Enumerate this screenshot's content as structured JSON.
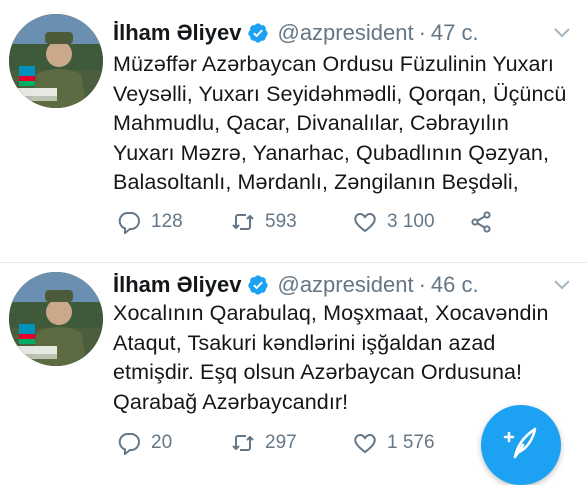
{
  "colors": {
    "accent": "#1da1f2",
    "verified": "#1da1f2",
    "muted": "#657786",
    "text": "#14171a"
  },
  "tweets": [
    {
      "author_name": "İlham Əliyev",
      "handle": "@azpresident",
      "separator": "·",
      "time": "47 с.",
      "avatar_caption": "QARABAĞ AZƏRBAYCANDIR!",
      "text": "Müzəffər Azərbaycan Ordusu Füzulinin Yuxarı Veysəlli, Yuxarı Seyidəhmədli, Qorqan, Üçüncü Mahmudlu, Qacar, Divanalılar, Cəbrayılın Yuxarı Məzrə, Yanarhac, Qubadlının Qəzyan, Balasoltanlı, Mərdanlı, Zəngilanın Beşdəli,",
      "replies": "128",
      "retweets": "593",
      "likes": "3 100",
      "icons": [
        "reply-icon",
        "retweet-icon",
        "like-icon",
        "share-icon",
        "chevron-down-icon",
        "verified-icon"
      ]
    },
    {
      "author_name": "İlham Əliyev",
      "handle": "@azpresident",
      "separator": "·",
      "time": "46 с.",
      "avatar_caption": "QARABAĞ AZƏRBAYCANDIR!",
      "text": "Xocalının Qarabulaq, Moşxmaat, Xocavəndin Ataqut, Tsakuri kəndlərini işğaldan azad etmişdir. Eşq olsun Azərbaycan Ordusuna! Qarabağ Azərbaycandır!",
      "replies": "20",
      "retweets": "297",
      "likes": "1 576",
      "icons": [
        "reply-icon",
        "retweet-icon",
        "like-icon",
        "share-icon",
        "chevron-down-icon",
        "verified-icon"
      ]
    }
  ],
  "compose_button": {
    "icon": "compose-tweet-icon"
  }
}
